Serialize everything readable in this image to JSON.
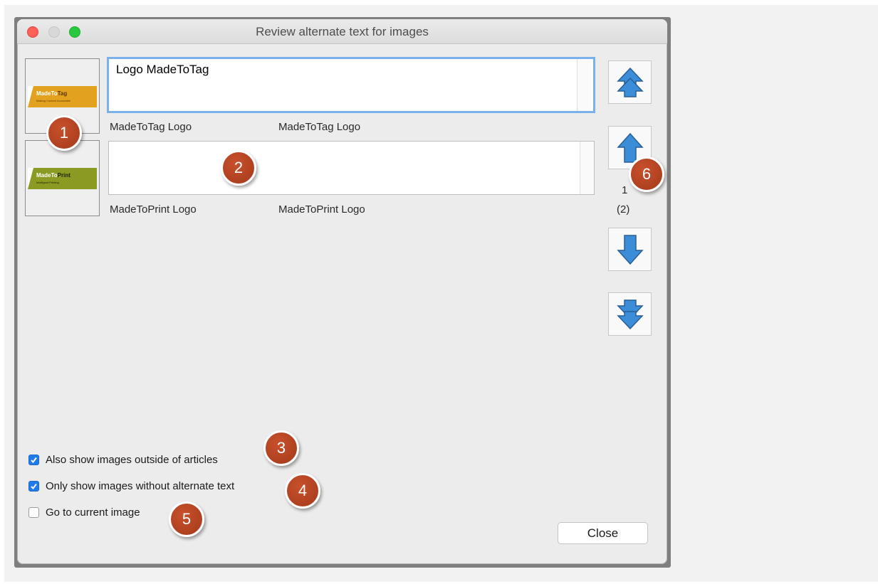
{
  "window": {
    "title": "Review alternate text for images"
  },
  "images": [
    {
      "logo_main": "MadeTo",
      "logo_accent": "Tag",
      "logo_tagline": "Making Content Accessible",
      "logo_bg": "#e2a11e",
      "logo_accent_color": "#5a3a00",
      "alt_text": "Logo MadeToTag",
      "label_left": "MadeToTag Logo",
      "label_right": "MadeToTag Logo"
    },
    {
      "logo_main": "MadeTo",
      "logo_accent": "Print",
      "logo_tagline": "Intelligent Printing",
      "logo_bg": "#8b9a23",
      "logo_accent_color": "#1c2300",
      "alt_text": "",
      "label_left": "MadeToPrint Logo",
      "label_right": "MadeToPrint Logo"
    }
  ],
  "navigation": {
    "current": "1",
    "total": "(2)"
  },
  "options": [
    {
      "label": "Also show images outside of articles",
      "checked": true
    },
    {
      "label": "Only show images without alternate text",
      "checked": true
    },
    {
      "label": "Go to current image",
      "checked": false
    }
  ],
  "close_label": "Close",
  "callouts": [
    "1",
    "2",
    "3",
    "4",
    "5",
    "6"
  ],
  "colors": {
    "arrow_fill": "#3b8dd8",
    "arrow_stroke": "#2a5f94",
    "badge": "#b2431f",
    "checkbox_on": "#1f7bec"
  }
}
